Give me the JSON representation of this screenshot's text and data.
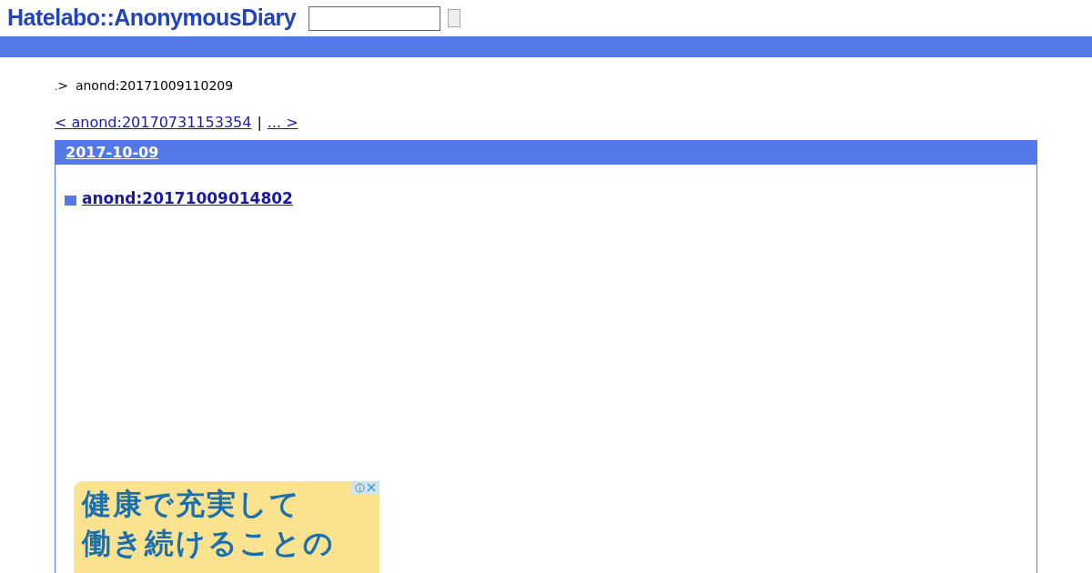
{
  "header": {
    "logo": "Hatelabo::AnonymousDiary"
  },
  "breadcrumb": {
    "home": ".",
    "separator": ">",
    "current": "anond:20171009110209"
  },
  "pager": {
    "prev": "< anond:20170731153354",
    "divider": "|",
    "next": "... >"
  },
  "day": {
    "date": "2017-10-09",
    "entries": [
      {
        "title": "anond:20171009014802"
      }
    ]
  },
  "ad": {
    "lines": [
      "健康で充実して",
      "働き続けることの"
    ]
  }
}
